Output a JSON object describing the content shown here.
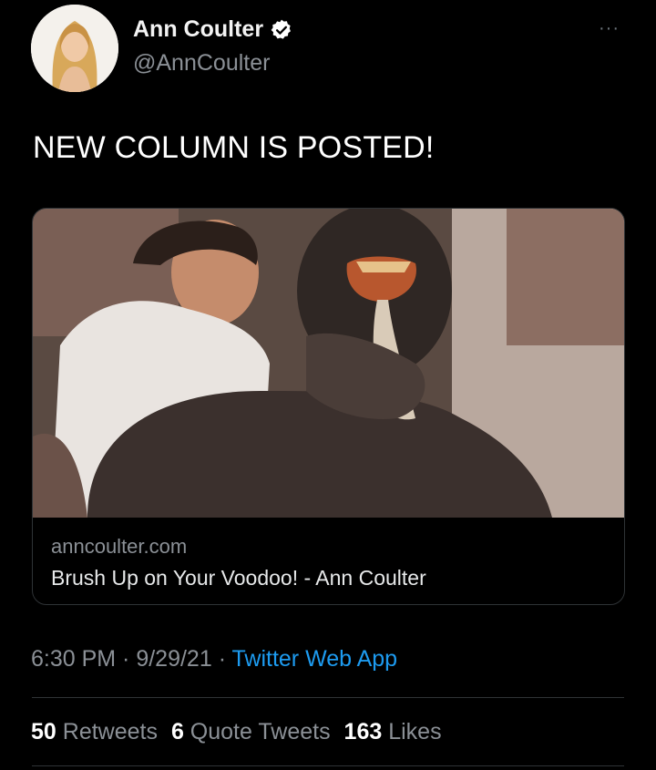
{
  "tweet": {
    "display_name": "Ann Coulter",
    "handle": "@AnnCoulter",
    "verified_icon": "verified-badge-icon",
    "more_label": "···",
    "text": "NEW COLUMN IS POSTED!"
  },
  "card": {
    "domain": "anncoulter.com",
    "title": "Brush Up on Your Voodoo! - Ann Coulter"
  },
  "meta": {
    "time": "6:30 PM",
    "separator1": " · ",
    "date": "9/29/21",
    "separator2": " · ",
    "source": "Twitter Web App"
  },
  "stats": {
    "retweets_count": "50",
    "retweets_label": "Retweets",
    "quotes_count": "6",
    "quotes_label": "Quote Tweets",
    "likes_count": "163",
    "likes_label": "Likes"
  },
  "colors": {
    "background": "#000000",
    "link": "#1d9bf0",
    "muted": "#8b9096",
    "verified": "#ffffff"
  }
}
